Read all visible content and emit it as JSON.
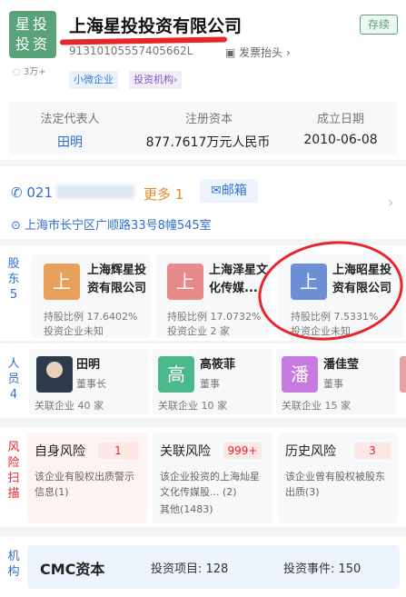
{
  "company": {
    "logo_text": [
      "星投",
      "投资"
    ],
    "fans": "3万+",
    "name": "上海星投投资有限公司",
    "status": "存续",
    "credit_code": "91310105557405662L",
    "invoice_label": "发票抬头",
    "tags": [
      "小微企业",
      "投资机构"
    ]
  },
  "info": {
    "headers": [
      "法定代表人",
      "注册资本",
      "成立日期"
    ],
    "values": [
      "田明",
      "877.7617万元人民币",
      "2010-06-08"
    ]
  },
  "contact": {
    "phone_prefix": "021",
    "more": "更多 1",
    "email": "邮箱",
    "address": "上海市长宁区广顺路33号8幢545室"
  },
  "shareholders": {
    "label": "股东",
    "count": "5",
    "items": [
      {
        "avatar": "上",
        "name": "上海辉星投资有限公司",
        "ratio": "持股比例 17.6402%",
        "sub": "投资企业未知",
        "color": "#e8a05a"
      },
      {
        "avatar": "上",
        "name": "上海泽星文化传媒...",
        "ratio": "持股比例 17.0732%",
        "sub": "投资企业 2 家",
        "color": "#e88a8a"
      },
      {
        "avatar": "上",
        "name": "上海昭星投资有限公司",
        "ratio": "持股比例 7.5331%",
        "sub": "投资企业未知",
        "color": "#6e8fd6"
      }
    ]
  },
  "personnel": {
    "label": "人员",
    "count": "4",
    "items": [
      {
        "avatar": "",
        "name": "田明",
        "role": "董事长",
        "related": "关联企业 40 家",
        "color": "#2d3a4a"
      },
      {
        "avatar": "高",
        "name": "高筱菲",
        "role": "董事",
        "related": "关联企业 10 家",
        "color": "#4cb98c"
      },
      {
        "avatar": "潘",
        "name": "潘佳莹",
        "role": "董事",
        "related": "关联企业 15 家",
        "color": "#c77be0"
      }
    ]
  },
  "risk": {
    "label": "风险扫描",
    "items": [
      {
        "title": "自身风险",
        "badge": "1",
        "desc": "该企业有股权出质警示信息(1)"
      },
      {
        "title": "关联风险",
        "badge": "999+",
        "desc": "该企业投资的上海灿星文化传媒股... (2)",
        "extra": "其他(1483)"
      },
      {
        "title": "历史风险",
        "badge": "3",
        "desc": "该企业曾有股权被股东出质(3)"
      }
    ]
  },
  "institution": {
    "label": "机构",
    "name": "CMC资本",
    "projects": "投资项目: 128",
    "events": "投资事件: 150"
  }
}
